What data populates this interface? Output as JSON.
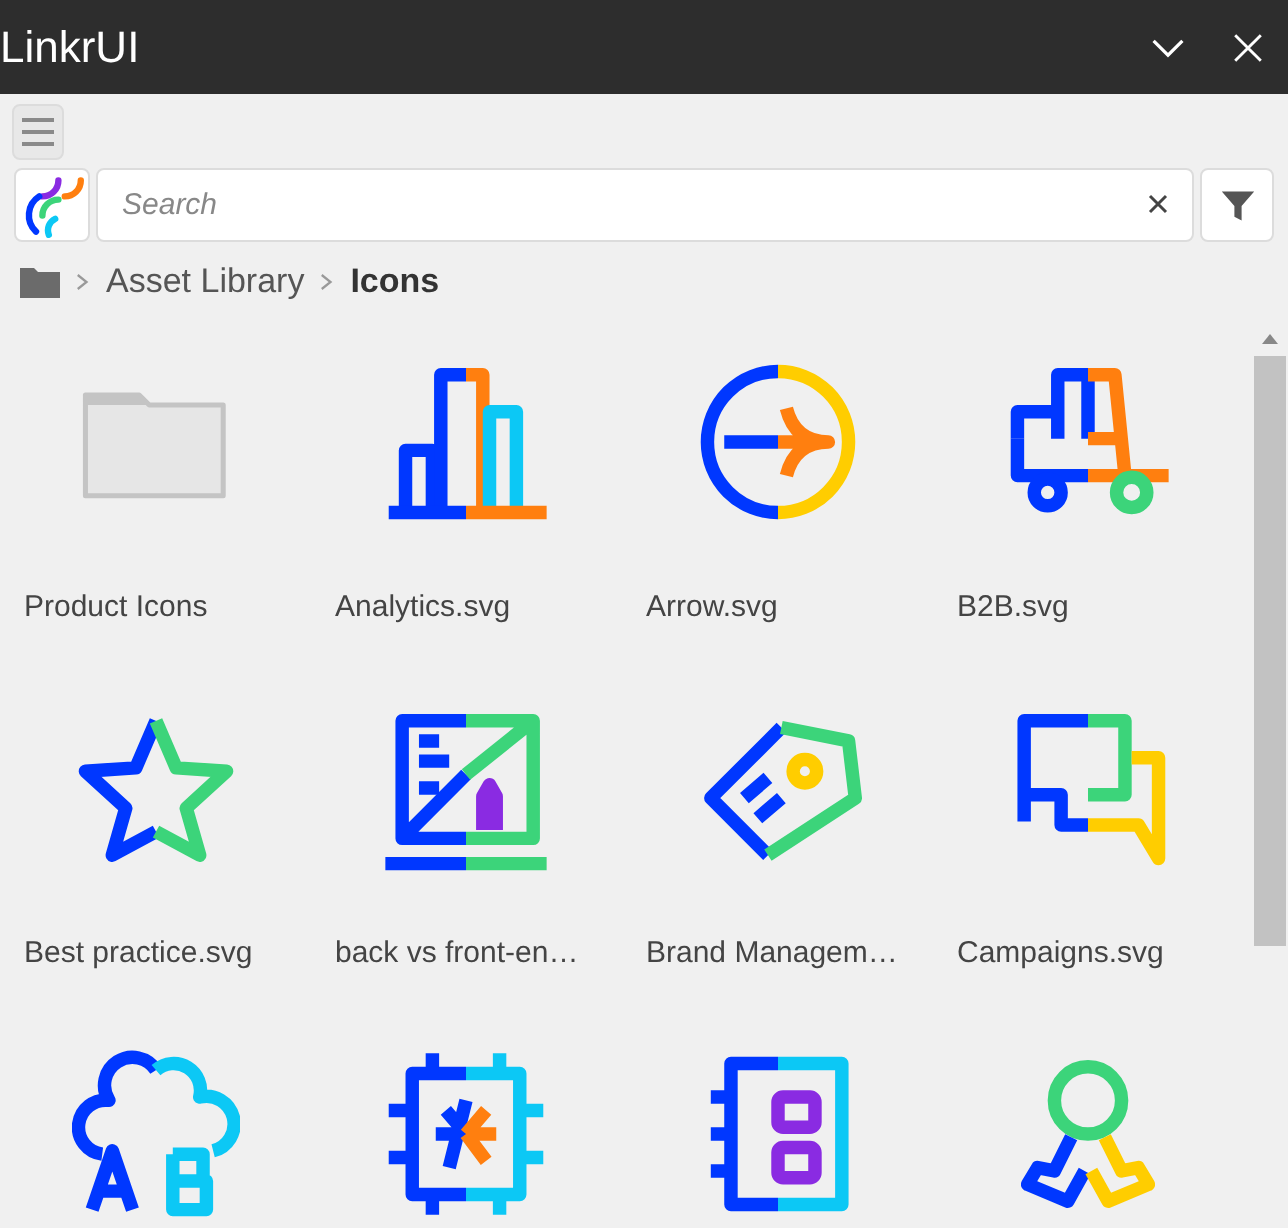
{
  "window": {
    "title": "LinkrUI"
  },
  "search": {
    "placeholder": "Search"
  },
  "breadcrumb": [
    {
      "label": "Asset Library",
      "current": false
    },
    {
      "label": "Icons",
      "current": true
    }
  ],
  "items": [
    {
      "kind": "folder",
      "name": "Product Icons"
    },
    {
      "kind": "analytics",
      "name": "Analytics.svg"
    },
    {
      "kind": "arrow",
      "name": "Arrow.svg"
    },
    {
      "kind": "truck",
      "name": "B2B.svg"
    },
    {
      "kind": "star",
      "name": "Best practice.svg"
    },
    {
      "kind": "laptop",
      "name": "back vs front-en…"
    },
    {
      "kind": "tag",
      "name": "Brand Managem…"
    },
    {
      "kind": "chat",
      "name": "Campaigns.svg"
    },
    {
      "kind": "cloud"
    },
    {
      "kind": "chip"
    },
    {
      "kind": "notebook"
    },
    {
      "kind": "award"
    }
  ]
}
